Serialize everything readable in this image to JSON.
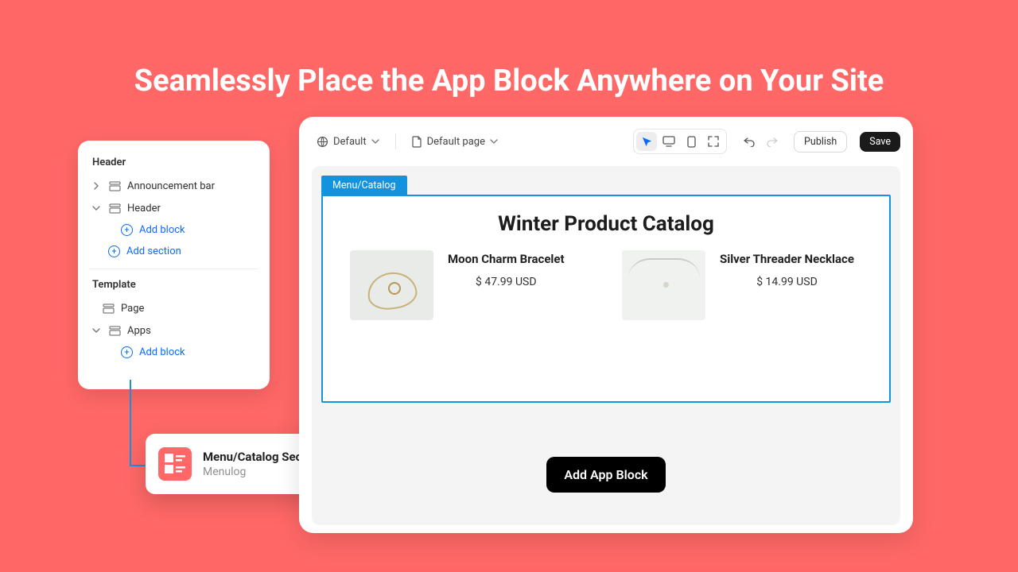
{
  "hero": {
    "title": "Seamlessly Place the App Block Anywhere on Your Site"
  },
  "sidebar": {
    "section1_label": "Header",
    "items1": [
      {
        "label": "Announcement bar"
      },
      {
        "label": "Header"
      }
    ],
    "add_block": "Add block",
    "add_section": "Add section",
    "section2_label": "Template",
    "items2": [
      {
        "label": "Page"
      },
      {
        "label": "Apps"
      }
    ]
  },
  "callout": {
    "title": "Menu/Catalog Section",
    "subtitle": "Menulog"
  },
  "topbar": {
    "preset": "Default",
    "page": "Default page",
    "publish": "Publish",
    "save": "Save"
  },
  "region": {
    "tab": "Menu/Catalog",
    "heading": "Winter Product Catalog",
    "products": [
      {
        "name": "Moon Charm Bracelet",
        "price": "$ 47.99 USD"
      },
      {
        "name": "Silver Threader Necklace",
        "price": "$ 14.99 USD"
      }
    ],
    "add_app_block": "Add App Block"
  }
}
